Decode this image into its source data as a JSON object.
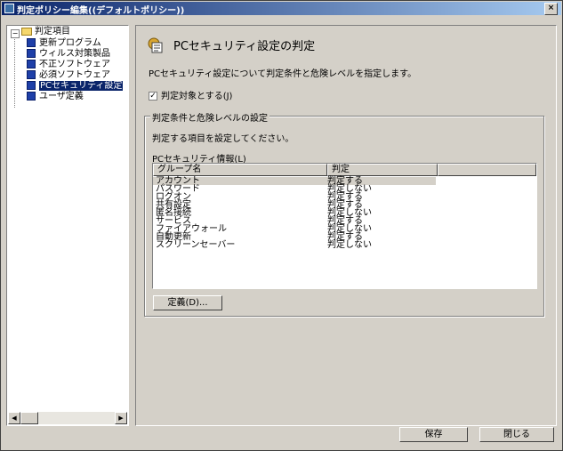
{
  "window": {
    "title": "判定ポリシー編集((デフォルトポリシー))",
    "close": "×"
  },
  "tree": {
    "root": "判定項目",
    "expander": "−",
    "items": [
      "更新プログラム",
      "ウィルス対策製品",
      "不正ソフトウェア",
      "必須ソフトウェア",
      "PCセキュリティ設定",
      "ユーザ定義"
    ],
    "selected_index": 4,
    "scroll_left": "◀",
    "scroll_right": "▶"
  },
  "panel": {
    "title": "PCセキュリティ設定の判定",
    "description": "PCセキュリティ設定について判定条件と危険レベルを指定します。",
    "checkbox_label": "判定対象とする(J)",
    "checkbox_checked": true,
    "checkbox_mark": "✓",
    "group_title": "判定条件と危険レベルの設定",
    "instruction": "判定する項目を設定してください。",
    "list_label": "PCセキュリティ情報(L)",
    "columns": [
      "グループ名",
      "判定"
    ],
    "rows": [
      {
        "group": "アカウント",
        "judge": "判定する"
      },
      {
        "group": "パスワード",
        "judge": "判定しない"
      },
      {
        "group": "ログオン",
        "judge": "判定する"
      },
      {
        "group": "共有設定",
        "judge": "判定する"
      },
      {
        "group": "匿名接続",
        "judge": "判定しない"
      },
      {
        "group": "サービス",
        "judge": "判定する"
      },
      {
        "group": "ファイアウォール",
        "judge": "判定しない"
      },
      {
        "group": "自動更新",
        "judge": "判定する"
      },
      {
        "group": "スクリーンセーバー",
        "judge": "判定しない"
      }
    ],
    "define_button": "定義(D)..."
  },
  "footer": {
    "save": "保存",
    "close": "閉じる"
  }
}
